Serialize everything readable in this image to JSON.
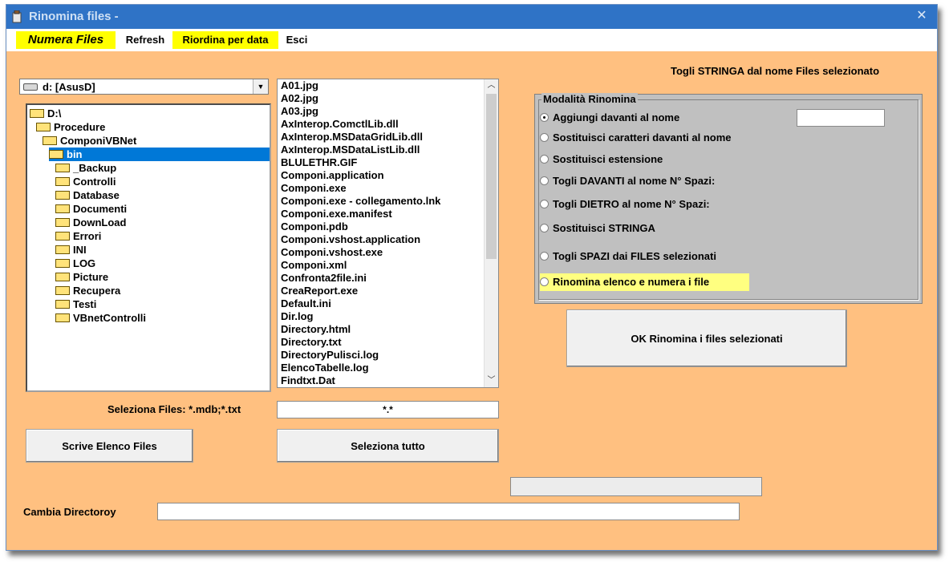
{
  "window": {
    "title": "Rinomina files -",
    "close_glyph": "✕"
  },
  "menu": [
    {
      "label": "Numera Files",
      "highlight": true
    },
    {
      "label": "Refresh",
      "highlight": false
    },
    {
      "label": "Riordina per data",
      "highlight": true
    },
    {
      "label": "Esci",
      "highlight": false
    }
  ],
  "heading_right": "Togli  STRINGA dal nome Files selezionato",
  "drive": {
    "label": "d: [AsusD]"
  },
  "dirs": [
    {
      "label": "D:\\",
      "indent": 0,
      "selected": false
    },
    {
      "label": "Procedure",
      "indent": 1,
      "selected": false
    },
    {
      "label": "ComponiVBNet",
      "indent": 2,
      "selected": false
    },
    {
      "label": "bin",
      "indent": 3,
      "selected": true
    },
    {
      "label": "_Backup",
      "indent": 4,
      "selected": false
    },
    {
      "label": "Controlli",
      "indent": 4,
      "selected": false
    },
    {
      "label": "Database",
      "indent": 4,
      "selected": false
    },
    {
      "label": "Documenti",
      "indent": 4,
      "selected": false
    },
    {
      "label": "DownLoad",
      "indent": 4,
      "selected": false
    },
    {
      "label": "Errori",
      "indent": 4,
      "selected": false
    },
    {
      "label": "INI",
      "indent": 4,
      "selected": false
    },
    {
      "label": "LOG",
      "indent": 4,
      "selected": false
    },
    {
      "label": "Picture",
      "indent": 4,
      "selected": false
    },
    {
      "label": "Recupera",
      "indent": 4,
      "selected": false
    },
    {
      "label": "Testi",
      "indent": 4,
      "selected": false
    },
    {
      "label": "VBnetControlli",
      "indent": 4,
      "selected": false
    }
  ],
  "files": [
    "A01.jpg",
    "A02.jpg",
    "A03.jpg",
    "AxInterop.ComctlLib.dll",
    "AxInterop.MSDataGridLib.dll",
    "AxInterop.MSDataListLib.dll",
    "BLULETHR.GIF",
    "Componi.application",
    "Componi.exe",
    "Componi.exe - collegamento.lnk",
    "Componi.exe.manifest",
    "Componi.pdb",
    "Componi.vshost.application",
    "Componi.vshost.exe",
    "Componi.xml",
    "Confronta2file.ini",
    "CreaReport.exe",
    "Default.ini",
    "Dir.log",
    "Directory.html",
    "Directory.txt",
    "DirectoryPulisci.log",
    "ElencoTabelle.log",
    "Findtxt.Dat"
  ],
  "filter": {
    "label": "Seleziona Files: *.mdb;*.txt",
    "value": "*.*"
  },
  "buttons": {
    "scrive": "Scrive Elenco Files",
    "seleziona": "Seleziona tutto",
    "ok": "OK Rinomina i files selezionati"
  },
  "group": {
    "title": "Modalità Rinomina",
    "options": [
      {
        "label": "Aggiungi davanti al nome",
        "checked": true
      },
      {
        "label": "Sostituisci caratteri davanti al nome",
        "checked": false
      },
      {
        "label": "Sostituisci estensione",
        "checked": false
      },
      {
        "label": "Togli  DAVANTI al nome N° Spazi:",
        "checked": false
      },
      {
        "label": "Togli  DIETRO al nome N° Spazi:",
        "checked": false
      },
      {
        "label": "Sostituisci STRINGA",
        "checked": false
      },
      {
        "label": "Togli SPAZI dai FILES selezionati",
        "checked": false
      },
      {
        "label": "Rinomina elenco e numera i file",
        "checked": false,
        "highlight": true
      }
    ],
    "prefix_value": ""
  },
  "cambia": {
    "label": "Cambia Directoroy",
    "value": ""
  },
  "status_value": "",
  "colors": {
    "background": "#FFC080",
    "titlebar": "#2f73c6",
    "highlight": "#ffff00",
    "selection": "#0078d7"
  },
  "icons": {
    "app": "app-icon",
    "close": "close-icon",
    "drive": "hard-drive-icon",
    "folder": "folder-icon",
    "dropdown": "chevron-down-icon"
  }
}
